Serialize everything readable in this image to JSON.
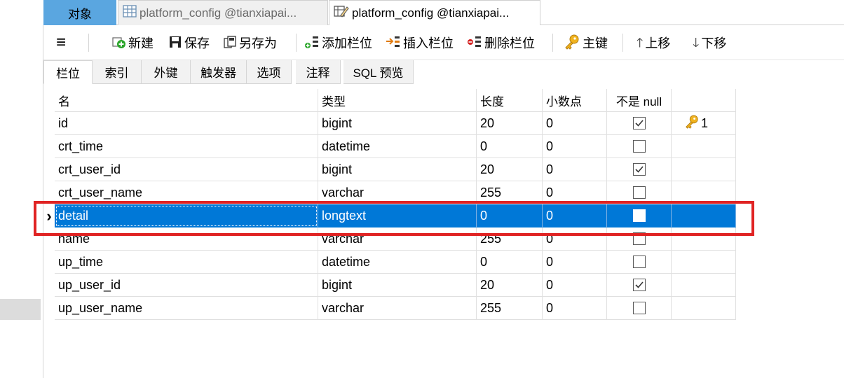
{
  "tabs": [
    {
      "label": "对象",
      "icon": "objects"
    },
    {
      "label": "platform_config @tianxiapai...",
      "icon": "table-icon"
    },
    {
      "label": "platform_config @tianxiapai...",
      "icon": "design-table-icon"
    }
  ],
  "toolbar": {
    "new_label": "新建",
    "save_label": "保存",
    "save_as_label": "另存为",
    "add_field_label": "添加栏位",
    "insert_field_label": "插入栏位",
    "delete_field_label": "删除栏位",
    "primary_key_label": "主键",
    "move_up_label": "上移",
    "move_down_label": "下移"
  },
  "subtabs": [
    "栏位",
    "索引",
    "外键",
    "触发器",
    "选项",
    "注释",
    "SQL 预览"
  ],
  "columns": {
    "name": "名",
    "type": "类型",
    "length": "长度",
    "decimals": "小数点",
    "not_null": "不是 null"
  },
  "rows": [
    {
      "name": "id",
      "type": "bigint",
      "length": "20",
      "decimals": "0",
      "not_null": true,
      "key": "1"
    },
    {
      "name": "crt_time",
      "type": "datetime",
      "length": "0",
      "decimals": "0",
      "not_null": false,
      "key": ""
    },
    {
      "name": "crt_user_id",
      "type": "bigint",
      "length": "20",
      "decimals": "0",
      "not_null": true,
      "key": ""
    },
    {
      "name": "crt_user_name",
      "type": "varchar",
      "length": "255",
      "decimals": "0",
      "not_null": false,
      "key": ""
    },
    {
      "name": "detail",
      "type": "longtext",
      "length": "0",
      "decimals": "0",
      "not_null": false,
      "key": "",
      "selected": true
    },
    {
      "name": "name",
      "type": "varchar",
      "length": "255",
      "decimals": "0",
      "not_null": false,
      "key": ""
    },
    {
      "name": "up_time",
      "type": "datetime",
      "length": "0",
      "decimals": "0",
      "not_null": false,
      "key": ""
    },
    {
      "name": "up_user_id",
      "type": "bigint",
      "length": "20",
      "decimals": "0",
      "not_null": true,
      "key": ""
    },
    {
      "name": "up_user_name",
      "type": "varchar",
      "length": "255",
      "decimals": "0",
      "not_null": false,
      "key": ""
    }
  ],
  "colors": {
    "selection": "#0078d7",
    "highlight_box": "#e02323",
    "objects_tab": "#5aa6e0"
  }
}
